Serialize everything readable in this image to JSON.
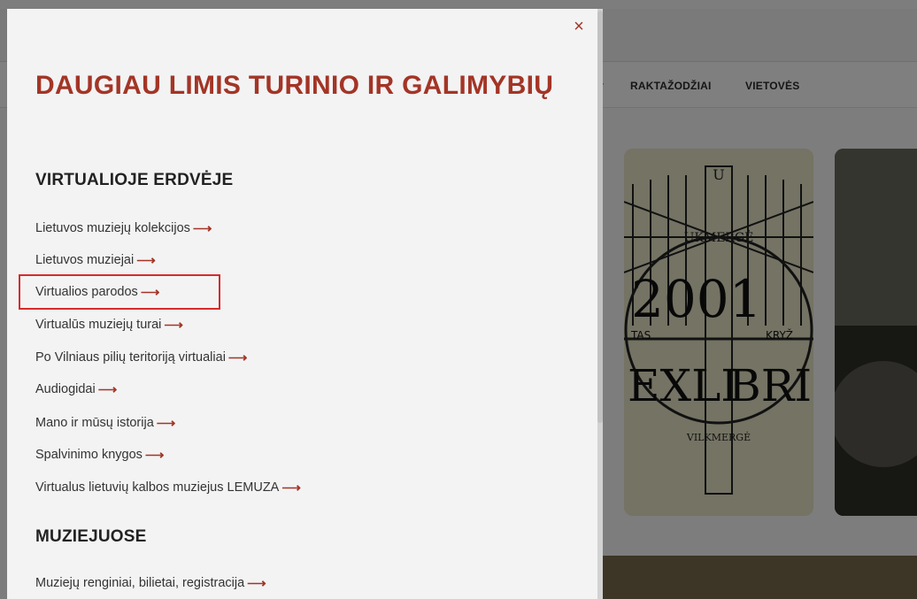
{
  "background": {
    "nav": {
      "dash": "-",
      "keywords": "RAKTAŽODŽIAI",
      "places": "VIETOVĖS"
    },
    "card_exlibris": {
      "title": "UKMERGĖ",
      "year": "2001",
      "ex": "EXLI",
      "bris": "BRIS",
      "city": "VILKMERGĖ",
      "row_left": "TAS",
      "row_right": "KRYŽ"
    }
  },
  "drawer": {
    "close_icon": "×",
    "title": "DAUGIAU LIMIS TURINIO IR GALIMYBIŲ",
    "sections": [
      {
        "title": "VIRTUALIOJE ERDVĖJE",
        "links": [
          "Lietuvos muziejų kolekcijos",
          "Lietuvos muziejai",
          "Virtualios parodos",
          "Virtualūs muziejų turai",
          "Po Vilniaus pilių teritoriją virtualiai",
          "Audiogidai",
          "Mano ir mūsų istorija",
          "Spalvinimo knygos",
          "Virtualus lietuvių kalbos muziejus LEMUZA"
        ]
      },
      {
        "title": "MUZIEJUOSE",
        "links": [
          "Muziejų renginiai, bilietai, registracija"
        ]
      }
    ],
    "arrow_icon": "⟶",
    "highlighted_link_index": 2,
    "accent_color": "#a33526",
    "highlight_color": "#d62b2b"
  }
}
